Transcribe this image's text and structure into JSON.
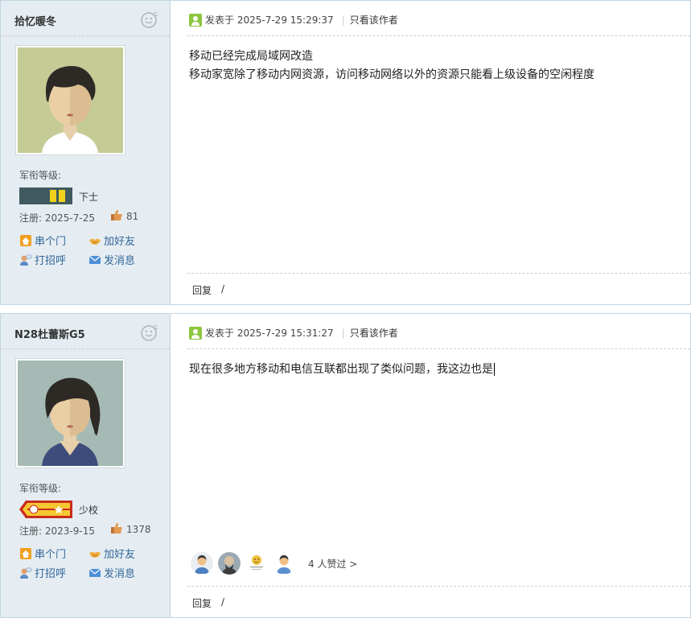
{
  "sidebar_labels": {
    "rank_label": "军衔等级:",
    "reg_prefix": "注册:",
    "visit": "串个门",
    "add_friend": "加好友",
    "greet": "打招呼",
    "message": "发消息"
  },
  "post_labels": {
    "posted_prefix": "发表于",
    "only_author": "只看该作者",
    "reply": "回复",
    "slash": "/"
  },
  "posts": [
    {
      "username": "拾忆暖冬",
      "rank": "下士",
      "reg_date": "2025-7-25",
      "likes": "81",
      "datetime": "2025-7-29 15:29:37",
      "content": [
        "移动已经完成局域网改造",
        "移动家宽除了移动内网资源，访问移动网络以外的资源只能看上级设备的空闲程度"
      ]
    },
    {
      "username": "N28杜蕾斯G5",
      "rank": "少校",
      "reg_date": "2023-9-15",
      "likes": "1378",
      "datetime": "2025-7-29 15:31:27",
      "content": [
        "现在很多地方移动和电信互联都出现了类似问题，我这边也是"
      ],
      "likers_count": "4 人赞过 >"
    }
  ],
  "colors": {
    "sidebar_bg": "#e5edf2",
    "border": "#c2d5e3",
    "link": "#336699"
  }
}
